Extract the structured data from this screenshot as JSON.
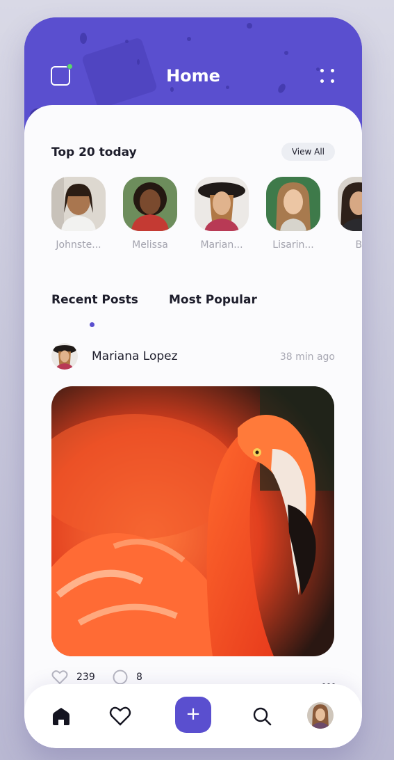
{
  "header": {
    "title": "Home",
    "left_icon": "notification-square-icon",
    "right_icon": "grid-dots-icon"
  },
  "top_section": {
    "title": "Top 20 today",
    "view_all_label": "View All"
  },
  "stories": [
    {
      "name": "Johnste..."
    },
    {
      "name": "Melissa"
    },
    {
      "name": "Marian..."
    },
    {
      "name": "Lisarin..."
    },
    {
      "name": "Ben"
    }
  ],
  "tabs": [
    {
      "label": "Recent Posts",
      "active": true
    },
    {
      "label": "Most Popular",
      "active": false
    }
  ],
  "post": {
    "author": "Mariana Lopez",
    "time": "38 min ago",
    "likes": "239",
    "comments": "8"
  },
  "bottom_nav": {
    "items": [
      "home-icon",
      "heart-icon",
      "add-icon",
      "search-icon",
      "profile-avatar"
    ],
    "add_symbol": "+"
  },
  "colors": {
    "accent": "#5a4fcf",
    "online_dot": "#59d66b"
  }
}
